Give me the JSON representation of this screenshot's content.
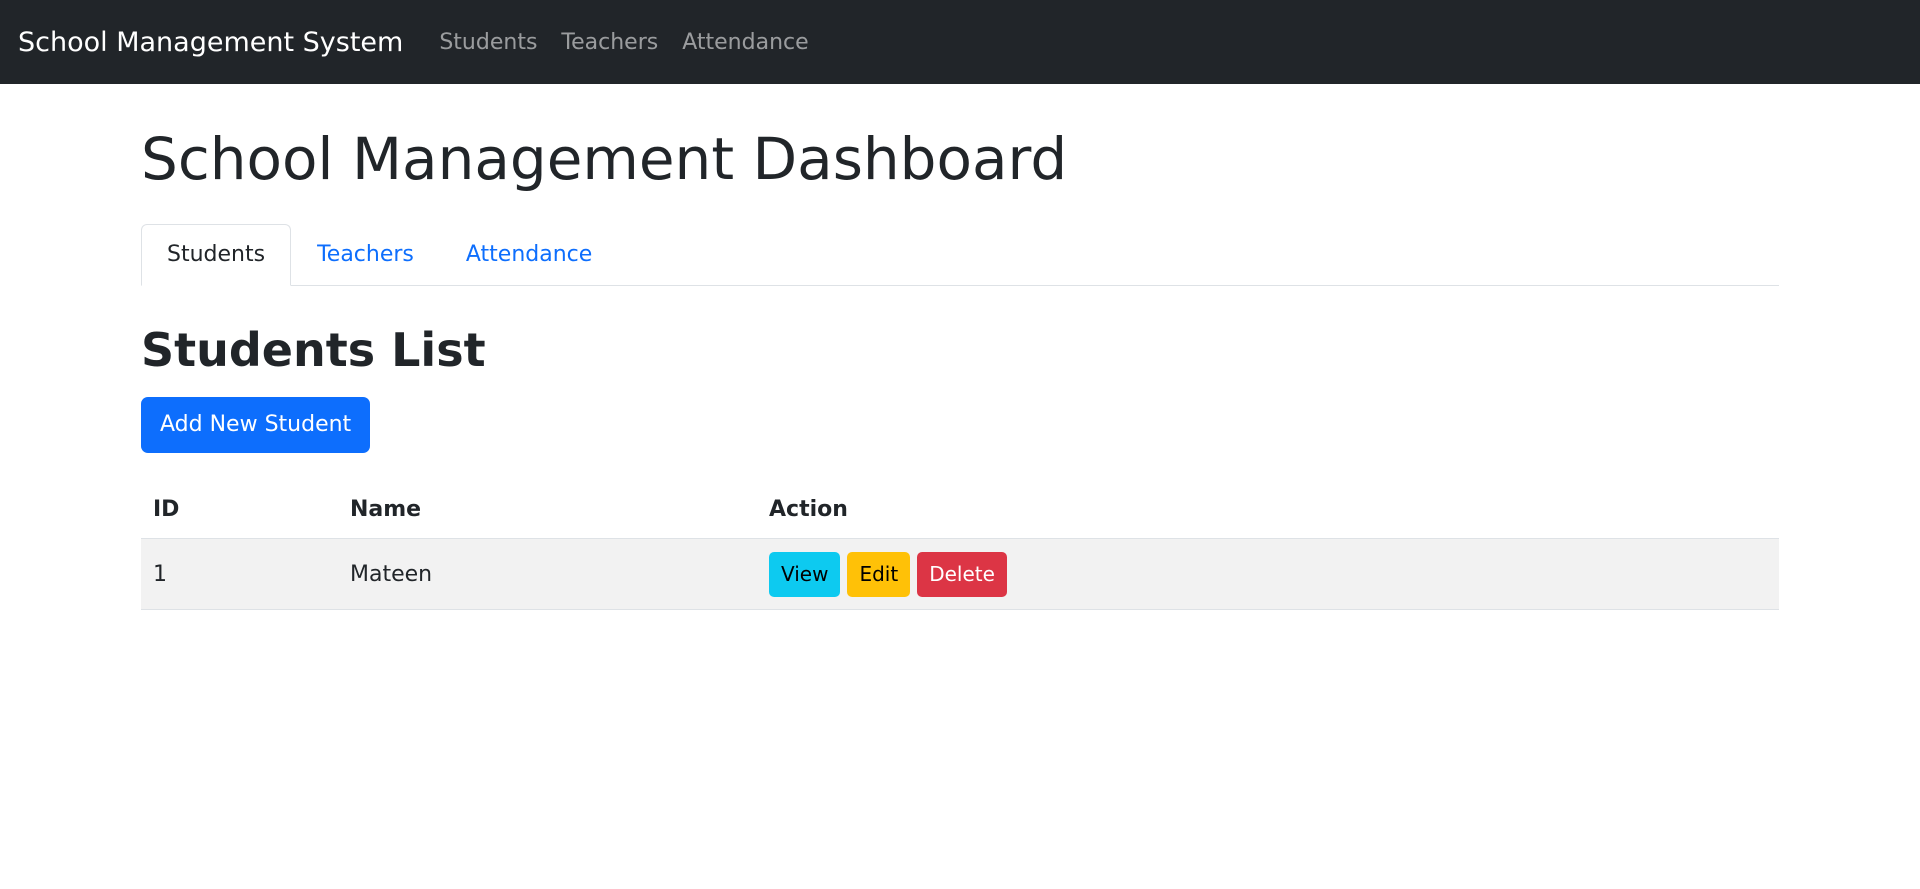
{
  "navbar": {
    "brand": "School Management System",
    "links": [
      "Students",
      "Teachers",
      "Attendance"
    ]
  },
  "page": {
    "title": "School Management Dashboard",
    "tabs": [
      {
        "label": "Students",
        "active": true
      },
      {
        "label": "Teachers",
        "active": false
      },
      {
        "label": "Attendance",
        "active": false
      }
    ]
  },
  "students": {
    "heading": "Students List",
    "add_button": "Add New Student",
    "columns": [
      "ID",
      "Name",
      "Action"
    ],
    "rows": [
      {
        "id": "1",
        "name": "Mateen"
      }
    ],
    "actions": {
      "view": "View",
      "edit": "Edit",
      "delete": "Delete"
    }
  },
  "colors": {
    "navbar_bg": "#212529",
    "primary": "#0d6efd",
    "info": "#0dcaf0",
    "warning": "#ffc107",
    "danger": "#dc3545"
  }
}
